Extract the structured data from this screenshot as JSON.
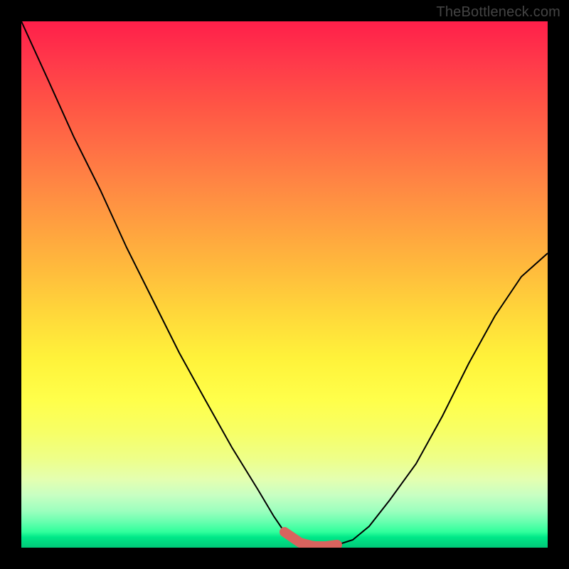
{
  "watermark": "TheBottleneck.com",
  "chart_data": {
    "type": "line",
    "title": "",
    "xlabel": "",
    "ylabel": "",
    "xlim": [
      0,
      100
    ],
    "ylim": [
      0,
      100
    ],
    "series": [
      {
        "name": "curve",
        "x": [
          0,
          5,
          10,
          15,
          20,
          25,
          30,
          35,
          40,
          45,
          48,
          50,
          53,
          56,
          58,
          60,
          63,
          66,
          70,
          75,
          80,
          85,
          90,
          95,
          100
        ],
        "y": [
          100,
          89,
          78,
          68,
          57,
          47,
          37,
          28,
          19,
          11,
          6,
          3,
          1,
          0.3,
          0.2,
          0.5,
          1.5,
          4,
          9,
          16,
          25,
          35,
          44,
          51,
          56
        ]
      }
    ],
    "accent_segment": {
      "name": "highlight",
      "x_start": 50,
      "x_end": 60,
      "color": "#d9635e"
    },
    "gradient_colors": {
      "top": "#ff1f4a",
      "mid": "#ffd93a",
      "bottom": "#00c878"
    }
  }
}
